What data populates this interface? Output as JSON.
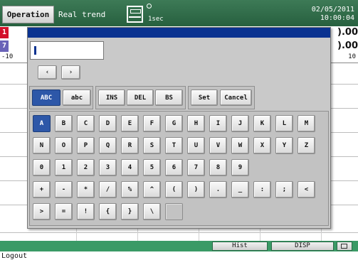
{
  "header": {
    "mode_tab": "Operation",
    "screen_title": "Real trend",
    "interval": "1sec",
    "date": "02/05/2011",
    "time": "10:00:04"
  },
  "trend": {
    "channels": [
      {
        "number": "1",
        "value": ").00",
        "color": "#d3102a"
      },
      {
        "number": "7",
        "value": ").00",
        "color": "#6a63b8"
      }
    ],
    "scale_left": "-10",
    "scale_right": "10"
  },
  "keyboard": {
    "input_value": "",
    "cursor_left": "‹",
    "cursor_right": "›",
    "mode_keys": [
      "ABC",
      "abc"
    ],
    "edit_keys": [
      "INS",
      "DEL",
      "BS"
    ],
    "set_label": "Set",
    "cancel_label": "Cancel",
    "rows": [
      [
        "A",
        "B",
        "C",
        "D",
        "E",
        "F",
        "G",
        "H",
        "I",
        "J",
        "K",
        "L",
        "M"
      ],
      [
        "N",
        "O",
        "P",
        "Q",
        "R",
        "S",
        "T",
        "U",
        "V",
        "W",
        "X",
        "Y",
        "Z"
      ],
      [
        "0",
        "1",
        "2",
        "3",
        "4",
        "5",
        "6",
        "7",
        "8",
        "9"
      ],
      [
        "+",
        "-",
        "*",
        "/",
        "%",
        "^",
        "(",
        ")",
        ".",
        "_",
        ":",
        ";",
        "<"
      ],
      [
        ">",
        "=",
        "!",
        "{",
        "}",
        "\\",
        ""
      ]
    ],
    "active_key": "A"
  },
  "statusbar": {
    "hist_label": "Hist",
    "disp_label": "DISP"
  },
  "footer": {
    "logout_label": "Logout"
  }
}
